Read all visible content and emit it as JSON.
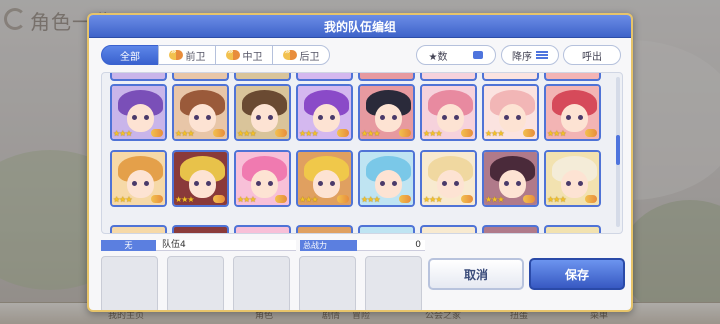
{
  "background": {
    "logo_text": "角色一览",
    "bottom_tabs": [
      "我的主页",
      "角色",
      "剧情",
      "冒险",
      "公会之家",
      "扭蛋",
      "菜单"
    ]
  },
  "dialog": {
    "title": "我的队伍编组",
    "filter_tabs": [
      {
        "label": "全部",
        "active": true
      },
      {
        "label": "前卫",
        "active": false
      },
      {
        "label": "中卫",
        "active": false
      },
      {
        "label": "后卫",
        "active": false
      }
    ],
    "sort_key_label": "★数",
    "sort_order_label": "降序",
    "call_label": "呼出",
    "roster": {
      "row1": [
        {
          "hair": "#7a4fb8",
          "bg": "#c9b5ea",
          "stars": "★★★",
          "role_icon": "position-badge"
        },
        {
          "hair": "#9a5a3a",
          "bg": "#e8c6a8",
          "stars": "★★★",
          "role_icon": "position-badge"
        },
        {
          "hair": "#6a4a32",
          "bg": "#d9c49a",
          "stars": "★★★",
          "role_icon": "position-badge"
        },
        {
          "hair": "#8a4ac8",
          "bg": "#d4b8ef",
          "stars": "★★★",
          "role_icon": "position-badge"
        },
        {
          "hair": "#2a2a3a",
          "bg": "#e79aa0",
          "stars": "★★★",
          "role_icon": "position-badge"
        },
        {
          "hair": "#e88aa0",
          "bg": "#f6d2dc",
          "stars": "★★★",
          "role_icon": "position-badge"
        },
        {
          "hair": "#f2b6b6",
          "bg": "#fbe3e0",
          "stars": "★★★",
          "role_icon": "position-badge"
        },
        {
          "hair": "#d64a5a",
          "bg": "#f3b4b4",
          "stars": "★★★",
          "role_icon": "position-badge"
        }
      ],
      "row2": [
        {
          "hair": "#e4a04a",
          "bg": "#f6d9a8",
          "stars": "★★★",
          "role_icon": "position-badge"
        },
        {
          "hair": "#e8c24a",
          "bg": "#8a3a3a",
          "stars": "★★★",
          "role_icon": "position-badge"
        },
        {
          "hair": "#f07ab0",
          "bg": "#f8c0d8",
          "stars": "★★★",
          "role_icon": "position-badge"
        },
        {
          "hair": "#f0c84a",
          "bg": "#e0a060",
          "stars": "★★★",
          "role_icon": "position-badge"
        },
        {
          "hair": "#7ac8e8",
          "bg": "#bfe4f2",
          "stars": "★★★",
          "role_icon": "position-badge"
        },
        {
          "hair": "#f0d8a0",
          "bg": "#f8ead0",
          "stars": "★★★",
          "role_icon": "position-badge"
        },
        {
          "hair": "#4a2a3a",
          "bg": "#b07a8a",
          "stars": "★★★",
          "role_icon": "position-badge"
        },
        {
          "hair": "#f4ecd8",
          "bg": "#f2e2b0",
          "stars": "★★★",
          "role_icon": "position-badge"
        }
      ]
    },
    "team_tag": "无",
    "team_name": "队伍4",
    "power_label": "总战力",
    "power_value": "0",
    "cancel_label": "取消",
    "save_label": "保存"
  }
}
